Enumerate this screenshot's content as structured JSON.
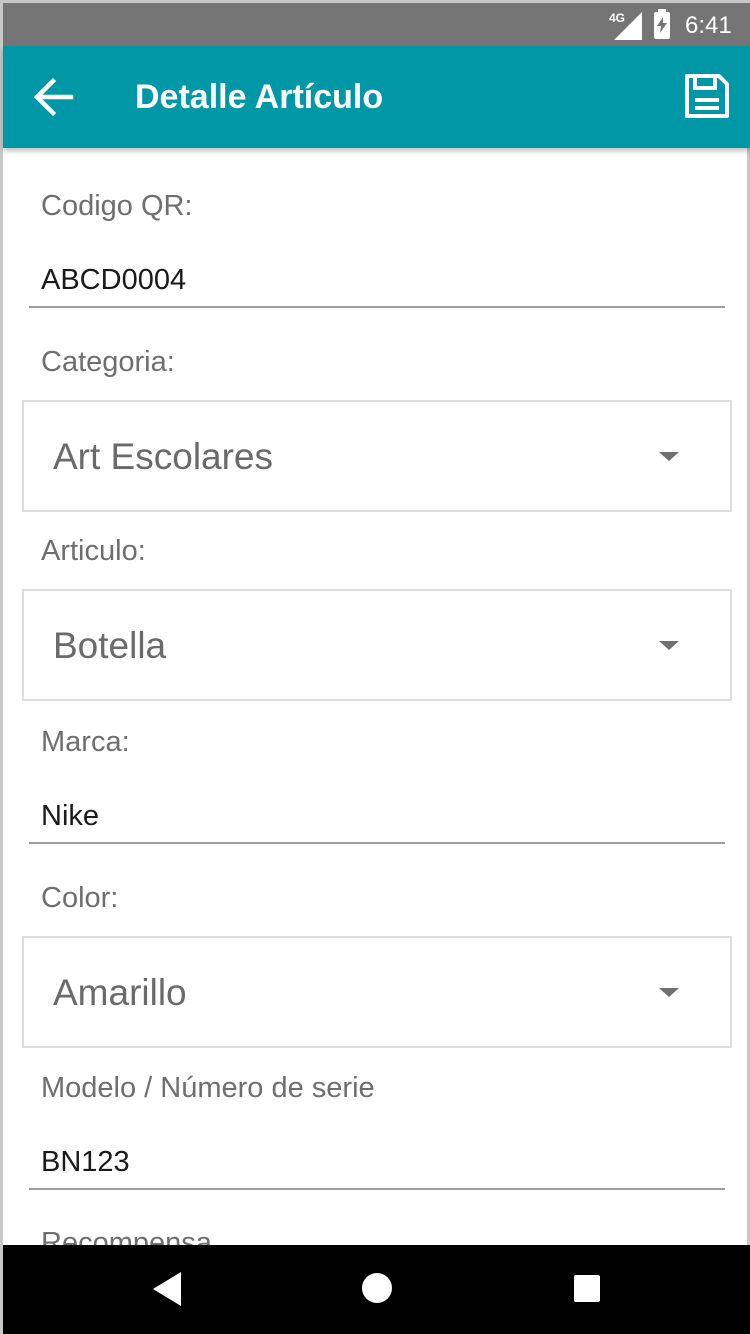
{
  "status_bar": {
    "network": "4G",
    "time": "6:41"
  },
  "app_bar": {
    "title": "Detalle Artículo",
    "back_icon": "arrow-left-icon",
    "save_icon": "floppy-disk-icon",
    "color": "#0097a7"
  },
  "form": {
    "qr": {
      "label": "Codigo QR:",
      "value": "ABCD0004"
    },
    "categoria": {
      "label": "Categoria:",
      "selected": "Art Escolares"
    },
    "articulo": {
      "label": "Articulo:",
      "selected": "Botella"
    },
    "marca": {
      "label": "Marca:",
      "value": "Nike"
    },
    "color": {
      "label": "Color:",
      "selected": "Amarillo"
    },
    "modelo": {
      "label": "Modelo / Número de serie",
      "value": "BN123"
    },
    "recompensa": {
      "label": "Recompensa"
    }
  },
  "nav_bar": {
    "back_icon": "triangle-back-icon",
    "home_icon": "circle-home-icon",
    "recents_icon": "square-recents-icon"
  }
}
